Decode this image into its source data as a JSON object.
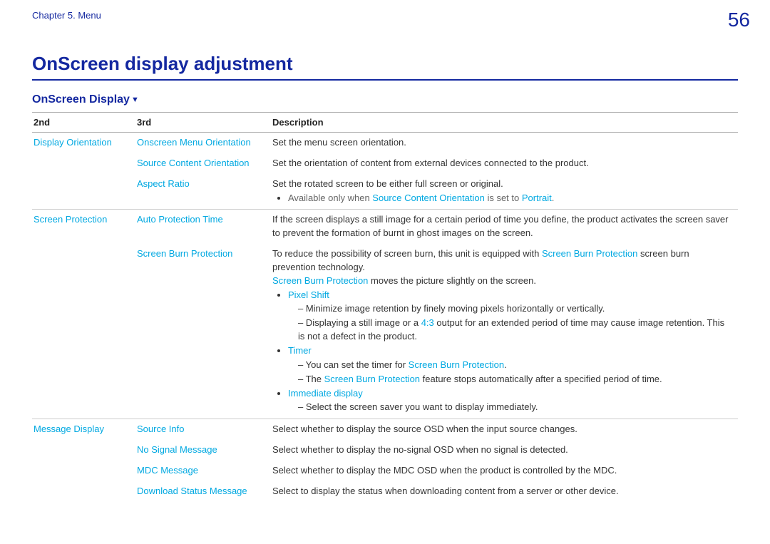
{
  "header": {
    "chapter": "Chapter 5. Menu",
    "page": "56"
  },
  "title": "OnScreen display adjustment",
  "section_label": "OnScreen Display",
  "columns": {
    "c2": "2nd",
    "c3": "3rd",
    "desc": "Description"
  },
  "rows": {
    "disp_orient": {
      "second": "Display Orientation",
      "onscreen_menu": {
        "third": "Onscreen Menu Orientation",
        "desc": "Set the menu screen orientation."
      },
      "source_content": {
        "third": "Source Content Orientation",
        "desc": "Set the orientation of content from external devices connected to the product."
      },
      "aspect_ratio": {
        "third": "Aspect Ratio",
        "desc": "Set the rotated screen to be either full screen or original.",
        "avail_prefix": "Available only when ",
        "avail_link1": "Source Content Orientation",
        "avail_mid": " is set to ",
        "avail_link2": "Portrait",
        "avail_suffix": "."
      }
    },
    "screen_protection": {
      "second": "Screen Protection",
      "auto_protection": {
        "third": "Auto Protection Time",
        "desc": "If the screen displays a still image for a certain period of time you define, the product activates the screen saver to prevent the formation of burnt in ghost images on the screen."
      },
      "screen_burn": {
        "third": "Screen Burn Protection",
        "intro_prefix": "To reduce the possibility of screen burn, this unit is equipped with ",
        "intro_link": "Screen Burn Protection",
        "intro_suffix": " screen burn prevention technology.",
        "moves_link": "Screen Burn Protection",
        "moves_suffix": " moves the picture slightly on the screen.",
        "pixel_shift_label": "Pixel Shift",
        "pixel_shift_item1": "Minimize image retention by finely moving pixels horizontally or vertically.",
        "pixel_shift_item2_prefix": "Displaying a still image or a ",
        "pixel_shift_item2_link": "4:3",
        "pixel_shift_item2_suffix": " output for an extended period of time may cause image retention. This is not a defect in the product.",
        "timer_label": "Timer",
        "timer_item1_prefix": "You can set the timer for ",
        "timer_item1_link": "Screen Burn Protection",
        "timer_item1_suffix": ".",
        "timer_item2_prefix": "The ",
        "timer_item2_link": "Screen Burn Protection",
        "timer_item2_suffix": " feature stops automatically after a specified period of time.",
        "immediate_label": "Immediate display",
        "immediate_item1": "Select the screen saver you want to display immediately."
      }
    },
    "message_display": {
      "second": "Message Display",
      "source_info": {
        "third": "Source Info",
        "desc": "Select whether to display the source OSD when the input source changes."
      },
      "no_signal": {
        "third": "No Signal Message",
        "desc": "Select whether to display the no-signal OSD when no signal is detected."
      },
      "mdc": {
        "third": "MDC Message",
        "desc": "Select whether to display the MDC OSD when the product is controlled by the MDC."
      },
      "download": {
        "third": "Download Status Message",
        "desc": "Select to display the status when downloading content from a server or other device."
      }
    }
  }
}
